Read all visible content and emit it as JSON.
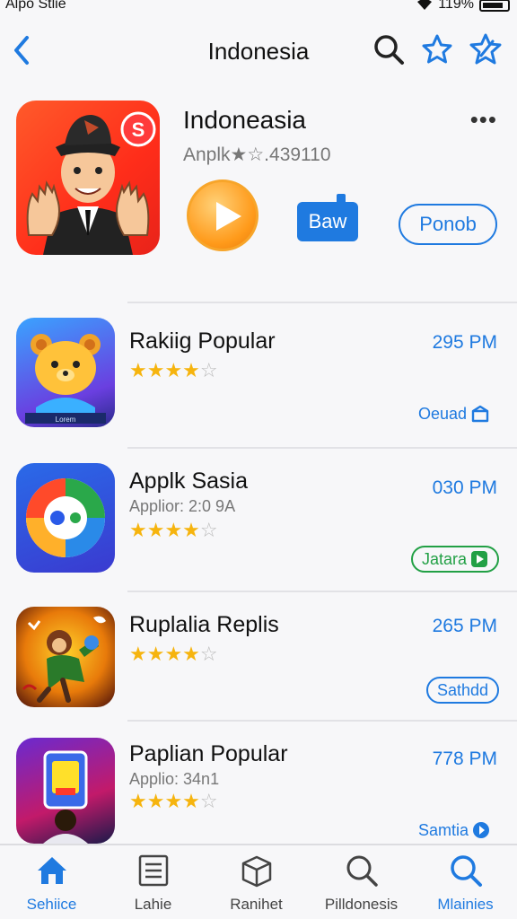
{
  "status_bar": {
    "carrier": "Alpo Stlie",
    "battery": "119%"
  },
  "nav": {
    "back_label": "<",
    "title": "Indonesia"
  },
  "featured": {
    "title": "Indoneasia",
    "subtitle": "Anplk★☆.439110",
    "more": "•••",
    "icon_badge": "S",
    "baw_label": "Baw",
    "ponob_label": "Ponob"
  },
  "apps": [
    {
      "title": "Rakiig Popular",
      "subtitle": "",
      "time": "295 PM",
      "rating": 4,
      "action": "Oeuad",
      "action_style": "plain-blue",
      "icon_caption": "Lorem"
    },
    {
      "title": "Applk Sasia",
      "subtitle": "Applior: 2:0 9A",
      "time": "030 PM",
      "rating": 4,
      "action": "Jatara",
      "action_style": "green"
    },
    {
      "title": "Ruplalia Replis",
      "subtitle": "",
      "time": "265 PM",
      "rating": 4,
      "action": "Sathdd",
      "action_style": "blue"
    },
    {
      "title": "Paplian Popular",
      "subtitle": "Applio: 34n1",
      "time": "778 PM",
      "rating": 4,
      "action": "Samtia",
      "action_style": "plain-blue"
    }
  ],
  "tabs": [
    {
      "label": "Sehiice",
      "icon": "home-icon",
      "active": true
    },
    {
      "label": "Lahie",
      "icon": "list-icon",
      "active": false
    },
    {
      "label": "Ranihet",
      "icon": "box-icon",
      "active": false
    },
    {
      "label": "Pilldonesis",
      "icon": "search-icon",
      "active": false
    },
    {
      "label": "Mlainies",
      "icon": "search-icon",
      "active": true
    }
  ],
  "colors": {
    "accent": "#1f7ae0",
    "star": "#f6b40e",
    "green": "#22a045"
  }
}
